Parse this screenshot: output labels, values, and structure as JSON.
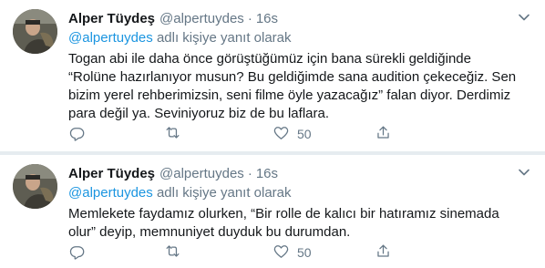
{
  "tweets": [
    {
      "author_name": "Alper Tüydeş",
      "author_handle": "@alpertuydes",
      "separator": "·",
      "time": "16s",
      "reply_mention": "@alpertuydes",
      "reply_suffix": " adlı kişiye yanıt olarak",
      "text": "Togan abi ile daha önce görüştüğümüz için bana sürekli geldiğinde\n“Rolüne hazırlanıyor musun? Bu geldiğimde sana audition çekeceğiz. Sen\nbizim yerel rehberimizsin, seni filme öyle yazacağız” falan diyor. Derdimiz\npara değil ya. Seviniyoruz biz de bu laflara.",
      "like_count": "50"
    },
    {
      "author_name": "Alper Tüydeş",
      "author_handle": "@alpertuydes",
      "separator": "·",
      "time": "16s",
      "reply_mention": "@alpertuydes",
      "reply_suffix": " adlı kişiye yanıt olarak",
      "text": "Memlekete faydamız olurken, “Bir rolle de kalıcı bir hatıramız sinemada\nolur” deyip, memnuniyet duyduk bu durumdan.",
      "like_count": "50"
    }
  ],
  "icons": {
    "reply": "reply-icon",
    "retweet": "retweet-icon",
    "like": "heart-icon",
    "share": "share-icon",
    "more": "chevron-down-icon"
  },
  "colors": {
    "link": "#1b95e0",
    "muted": "#657786",
    "text": "#14171a",
    "divider": "#e6ecf0"
  }
}
